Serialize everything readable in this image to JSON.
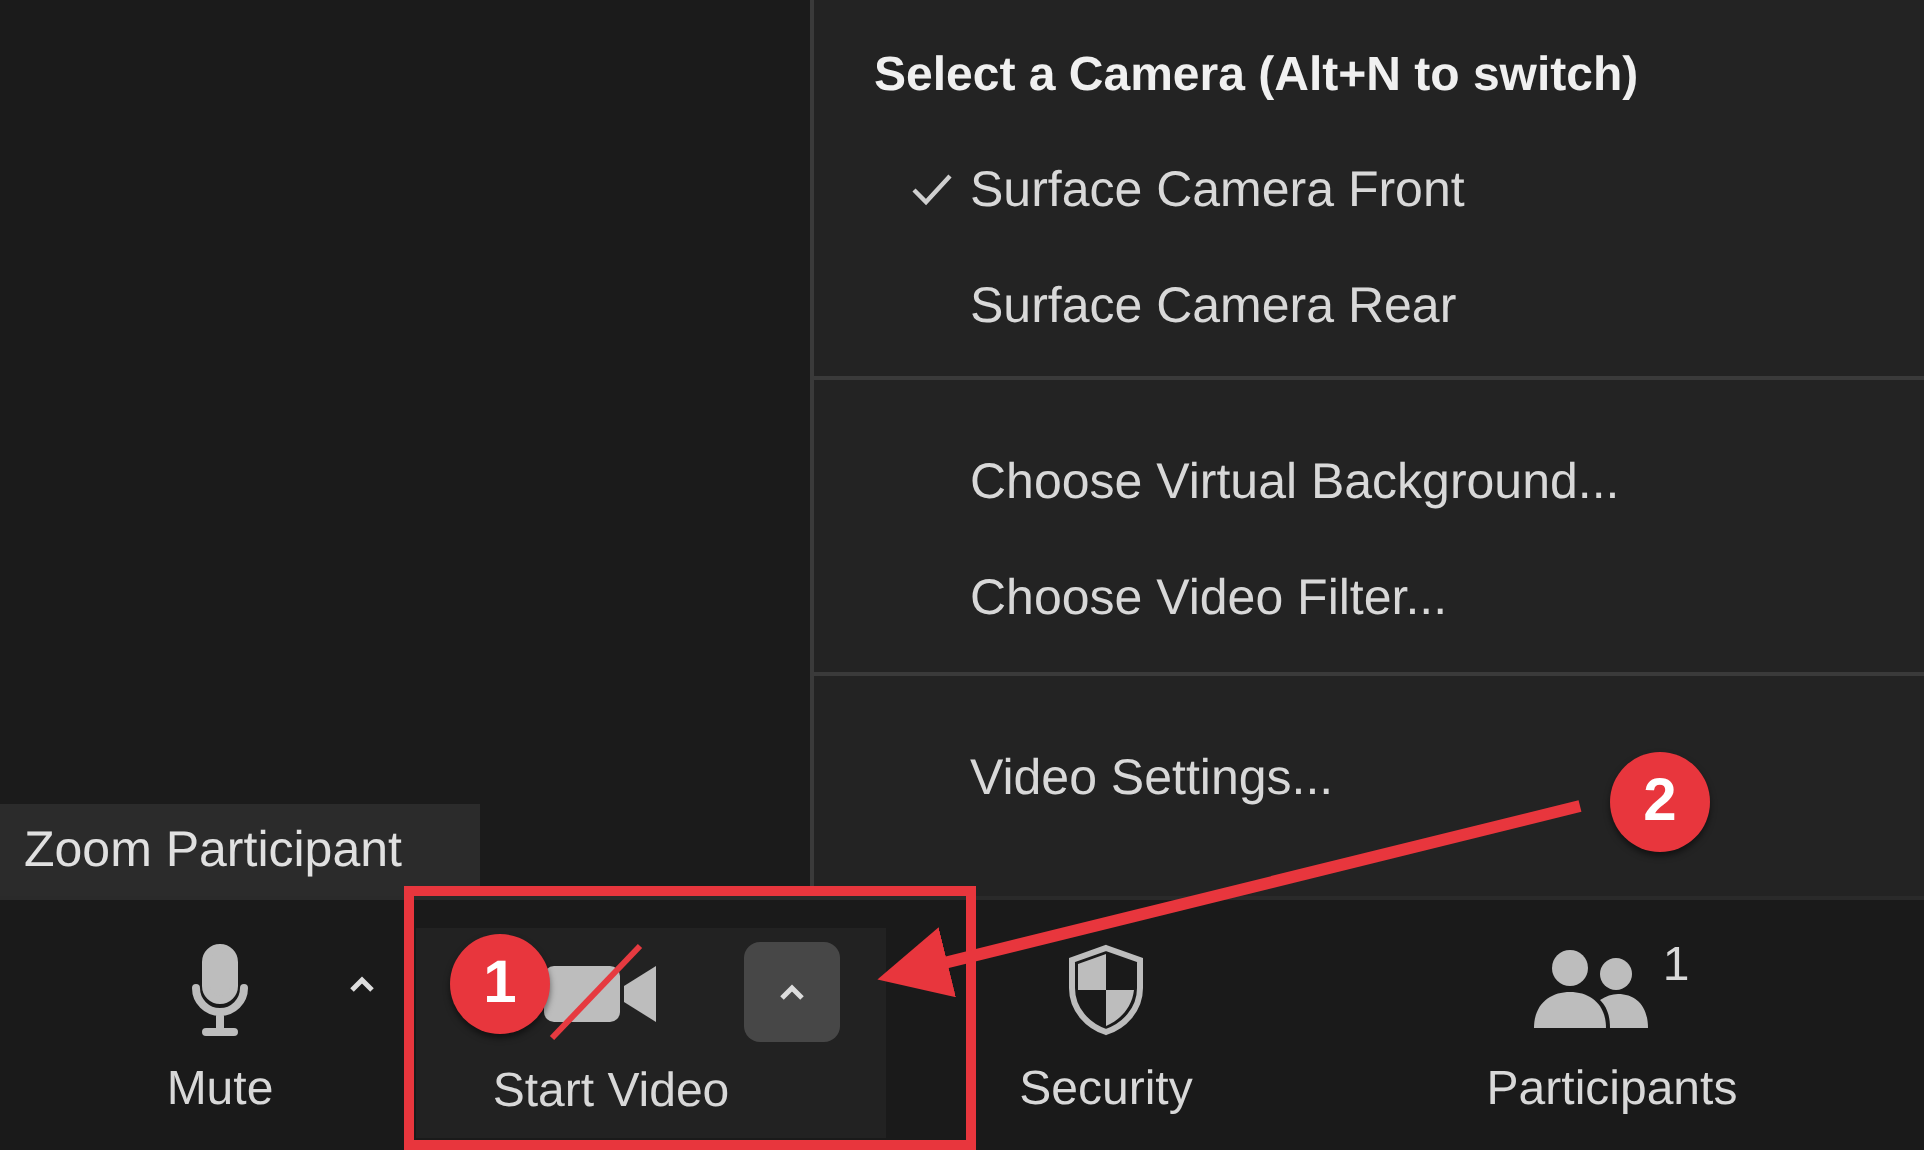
{
  "tooltip": "Zoom Participant",
  "camera_menu": {
    "title": "Select a Camera (Alt+N to switch)",
    "sections": [
      {
        "items": [
          {
            "label": "Surface Camera Front",
            "checked": true
          },
          {
            "label": "Surface Camera Rear",
            "checked": false
          }
        ]
      },
      {
        "items": [
          {
            "label": "Choose Virtual Background...",
            "checked": false
          },
          {
            "label": "Choose Video Filter...",
            "checked": false
          }
        ]
      },
      {
        "items": [
          {
            "label": "Video Settings...",
            "checked": false
          }
        ]
      }
    ]
  },
  "toolbar": [
    {
      "kind": "mute",
      "label": "Mute"
    },
    {
      "kind": "video",
      "label": "Start Video"
    },
    {
      "kind": "security",
      "label": "Security"
    },
    {
      "kind": "participants",
      "label": "Participants",
      "count": "1"
    }
  ],
  "annotations": [
    {
      "kind": "badge",
      "text": "1"
    },
    {
      "kind": "badge",
      "text": "2"
    }
  ]
}
